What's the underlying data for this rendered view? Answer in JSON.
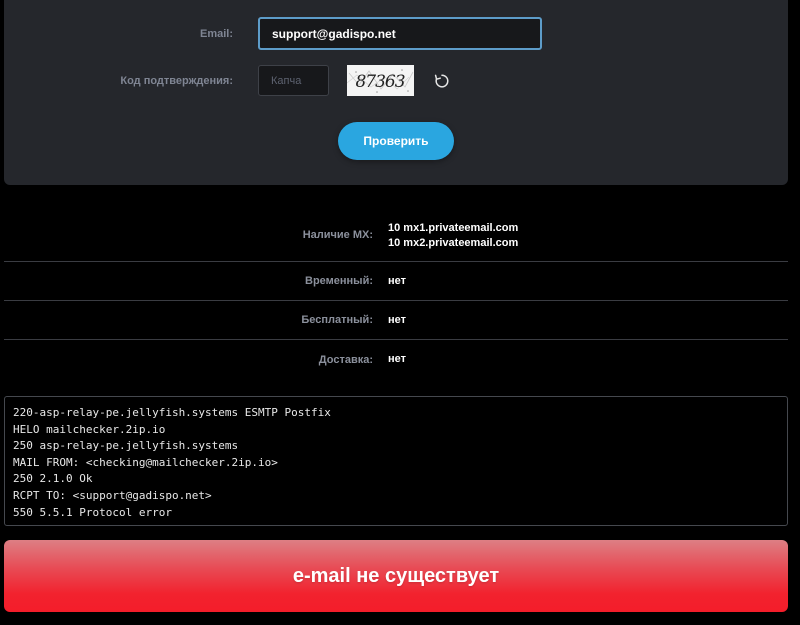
{
  "form": {
    "email_label": "Email:",
    "email_value": "support@gadispo.net",
    "captcha_label": "Код подтверждения:",
    "captcha_placeholder": "Капча",
    "captcha_text": "87363",
    "check_button": "Проверить"
  },
  "results": {
    "mx": {
      "label": "Наличие MX:",
      "values": [
        "10 mx1.privateemail.com",
        "10 mx2.privateemail.com"
      ]
    },
    "temporary": {
      "label": "Временный:",
      "value": "нет"
    },
    "free": {
      "label": "Бесплатный:",
      "value": "нет"
    },
    "delivery": {
      "label": "Доставка:",
      "value": "нет"
    }
  },
  "smtp_log": [
    "220-asp-relay-pe.jellyfish.systems ESMTP Postfix",
    "HELO mailchecker.2ip.io",
    "250 asp-relay-pe.jellyfish.systems",
    "MAIL FROM: <checking@mailchecker.2ip.io>",
    "250 2.1.0 Ok",
    "RCPT TO: <support@gadispo.net>",
    "550 5.5.1 Protocol error"
  ],
  "banner": {
    "text": "e-mail не существует"
  },
  "colors": {
    "card_bg": "#25272c",
    "accent": "#2aa6e0",
    "email_border": "#5d9cc9",
    "error_red": "#f2222e"
  },
  "icons": {
    "refresh": "refresh-icon"
  }
}
